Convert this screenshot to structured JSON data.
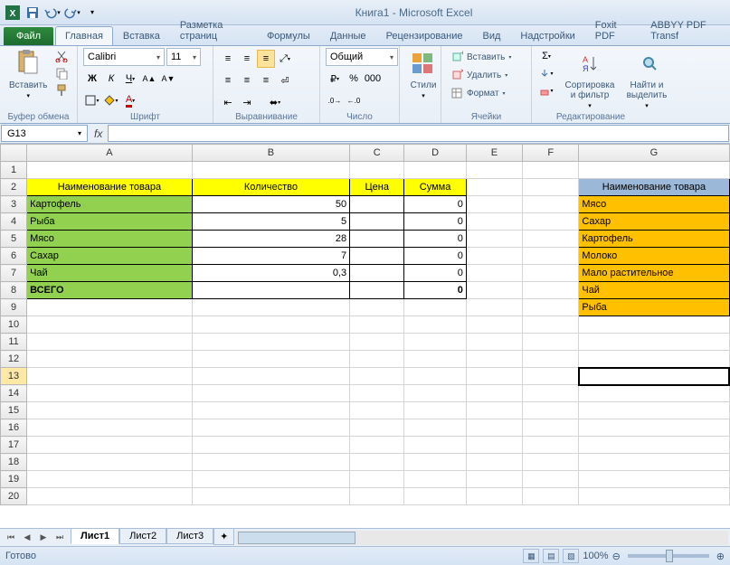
{
  "title": "Книга1 - Microsoft Excel",
  "qat": {
    "save": "save",
    "undo": "undo",
    "redo": "redo"
  },
  "tabs": {
    "file": "Файл",
    "list": [
      "Главная",
      "Вставка",
      "Разметка страниц",
      "Формулы",
      "Данные",
      "Рецензирование",
      "Вид",
      "Надстройки",
      "Foxit PDF",
      "ABBYY PDF Transf"
    ],
    "active": 0
  },
  "ribbon": {
    "clipboard": {
      "label": "Буфер обмена",
      "paste": "Вставить"
    },
    "font": {
      "label": "Шрифт",
      "name": "Calibri",
      "size": "11"
    },
    "alignment": {
      "label": "Выравнивание"
    },
    "number": {
      "label": "Число",
      "format": "Общий"
    },
    "styles": {
      "label": "Стили",
      "cond": "Стили"
    },
    "cells": {
      "label": "Ячейки",
      "insert": "Вставить",
      "delete": "Удалить",
      "format": "Формат"
    },
    "editing": {
      "label": "Редактирование",
      "sort": "Сортировка и фильтр",
      "find": "Найти и выделить"
    }
  },
  "namebox": "G13",
  "formula": "",
  "columns": [
    "A",
    "B",
    "C",
    "D",
    "E",
    "F",
    "G"
  ],
  "rowcount": 20,
  "selected_row": 13,
  "data": {
    "headers1": {
      "A": "Наименование товара",
      "B": "Количество",
      "C": "Цена",
      "D": "Сумма"
    },
    "headers2": {
      "G": "Наименование товара"
    },
    "rows": [
      {
        "A": "Картофель",
        "B": "50",
        "D": "0",
        "G": "Мясо"
      },
      {
        "A": "Рыба",
        "B": "5",
        "D": "0",
        "G": "Сахар"
      },
      {
        "A": "Мясо",
        "B": "28",
        "D": "0",
        "G": "Картофель"
      },
      {
        "A": "Сахар",
        "B": "7",
        "D": "0",
        "G": "Молоко"
      },
      {
        "A": "Чай",
        "B": "0,3",
        "D": "0",
        "G": "Мало растительное"
      },
      {
        "A": "ВСЕГО",
        "B": "",
        "D": "0",
        "G": "Чай",
        "bold": true
      },
      {
        "G": "Рыба"
      }
    ]
  },
  "sheets": {
    "list": [
      "Лист1",
      "Лист2",
      "Лист3"
    ],
    "active": 0
  },
  "status": {
    "ready": "Готово",
    "zoom": "100%"
  }
}
